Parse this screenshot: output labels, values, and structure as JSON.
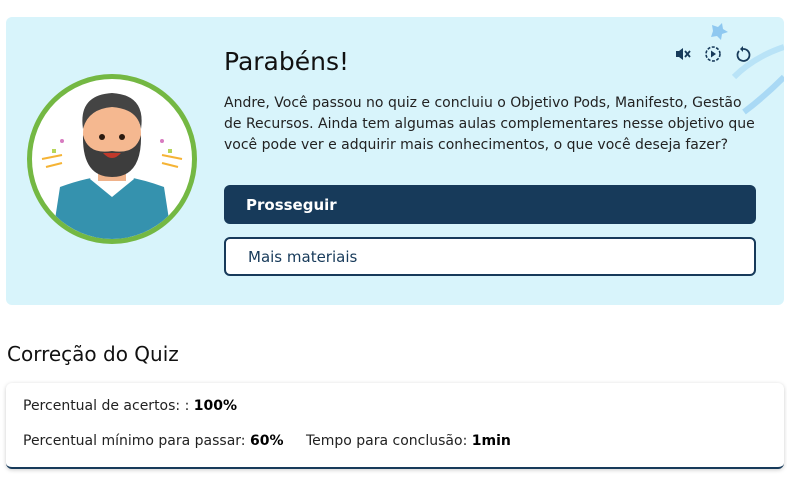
{
  "banner": {
    "title": "Parabéns!",
    "message": "Andre, Você passou no quiz e concluiu o Objetivo Pods, Manifesto, Gestão de Recursos. Ainda tem algumas aulas complementares nesse objetivo que você pode ver e adquirir mais conhecimentos, o que você deseja fazer?",
    "primary_button": "Prosseguir",
    "secondary_button": "Mais materiais",
    "icons": [
      "volume-mute-icon",
      "play-circle-icon",
      "replay-icon"
    ]
  },
  "quiz": {
    "heading": "Correção do Quiz",
    "score_label": "Percentual de acertos: :",
    "score_value": "100%",
    "min_label": "Percentual mínimo para passar:",
    "min_value": "60%",
    "time_label": "Tempo para conclusão:",
    "time_value": "1min"
  },
  "colors": {
    "banner_bg": "#d8f4fb",
    "primary": "#173a5a",
    "avatar_ring": "#74b843"
  }
}
